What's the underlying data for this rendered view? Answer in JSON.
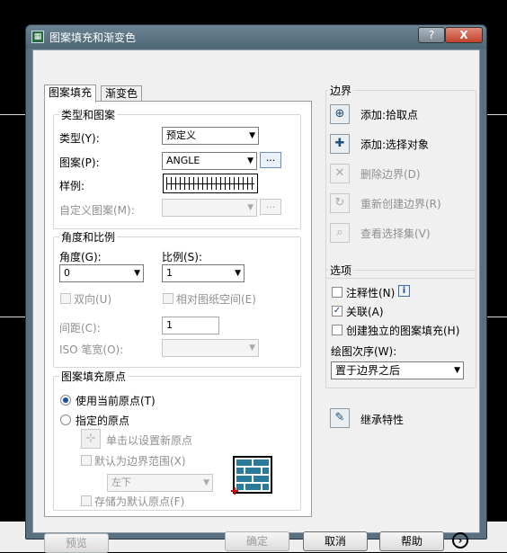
{
  "window": {
    "title": "图案填充和渐变色",
    "help_glyph": "?",
    "close_glyph": "X"
  },
  "tabs": [
    {
      "label": "图案填充",
      "active": true
    },
    {
      "label": "渐变色",
      "active": false
    }
  ],
  "type_pattern": {
    "legend": "类型和图案",
    "type_label": "类型(Y):",
    "type_value": "预定义",
    "pattern_label": "图案(P):",
    "pattern_value": "ANGLE",
    "pattern_browse": "...",
    "swatch_label": "样例:",
    "custom_label": "自定义图案(M):",
    "custom_value": "",
    "custom_browse": "..."
  },
  "angle_scale": {
    "legend": "角度和比例",
    "angle_label": "角度(G):",
    "angle_value": "0",
    "scale_label": "比例(S):",
    "scale_value": "1",
    "double_label": "双向(U)",
    "relative_label": "相对图纸空间(E)",
    "spacing_label": "间距(C):",
    "spacing_value": "1",
    "iso_label": "ISO 笔宽(O):",
    "iso_value": ""
  },
  "origin": {
    "legend": "图案填充原点",
    "use_current_label": "使用当前原点(T)",
    "specified_label": "指定的原点",
    "click_set_label": "单击以设置新原点",
    "default_extents_label": "默认为边界范围(X)",
    "extents_value": "左下",
    "store_default_label": "存储为默认原点(F)"
  },
  "boundaries": {
    "legend": "边界",
    "add_pick": "添加:拾取点",
    "add_select": "添加:选择对象",
    "remove": "删除边界(D)",
    "recreate": "重新创建边界(R)",
    "view": "查看选择集(V)"
  },
  "options": {
    "legend": "选项",
    "annotative_label": "注释性(N)",
    "info_glyph": "i",
    "associative_label": "关联(A)",
    "associative_checked": true,
    "separate_label": "创建独立的图案填充(H)",
    "draw_order_label": "绘图次序(W):",
    "draw_order_value": "置于边界之后",
    "check_glyph": "✓"
  },
  "inherit_label": "继承特性",
  "footer": {
    "preview": "预览",
    "ok": "确定",
    "cancel": "取消",
    "help": "帮助",
    "more_glyph": "›"
  },
  "icons": [
    "pick-points-icon",
    "select-objects-icon",
    "remove-boundary-icon",
    "recreate-boundary-icon",
    "view-selection-icon",
    "inherit-properties-icon",
    "click-origin-icon",
    "brick-origin-preview-icon"
  ],
  "colors": {
    "titlebar": "#5a7080",
    "close": "#c1432b",
    "radio_dot": "#1a4fa0",
    "brick": "#2a7a9a"
  }
}
